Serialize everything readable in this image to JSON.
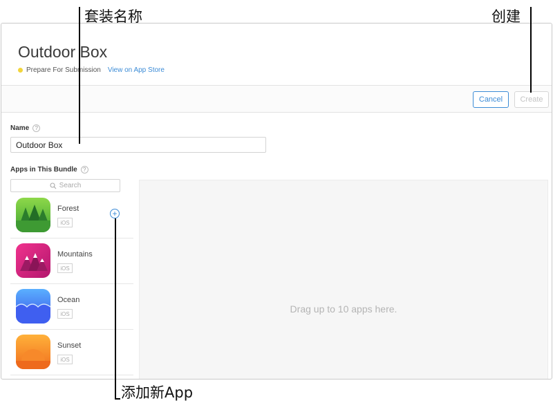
{
  "annotations": {
    "bundle_name": "套装名称",
    "create": "创建",
    "add_app": "添加新App"
  },
  "header": {
    "title": "Outdoor Box",
    "status": "Prepare For Submission",
    "store_link": "View on App Store",
    "status_color": "#f2d53c"
  },
  "toolbar": {
    "cancel": "Cancel",
    "create": "Create"
  },
  "form": {
    "name_label": "Name",
    "name_value": "Outdoor Box",
    "help": "?",
    "apps_label": "Apps in This Bundle",
    "search_placeholder": "Search"
  },
  "apps": [
    {
      "name": "Forest",
      "platform": "iOS",
      "icon": "forest-icon"
    },
    {
      "name": "Mountains",
      "platform": "iOS",
      "icon": "mountains-icon"
    },
    {
      "name": "Ocean",
      "platform": "iOS",
      "icon": "ocean-icon"
    },
    {
      "name": "Sunset",
      "platform": "iOS",
      "icon": "sunset-icon"
    }
  ],
  "add_symbol": "+",
  "drop_zone": {
    "text": "Drag up to 10 apps here."
  },
  "colors": {
    "accent": "#3b8bd6",
    "disabled": "#c3c3c3"
  }
}
